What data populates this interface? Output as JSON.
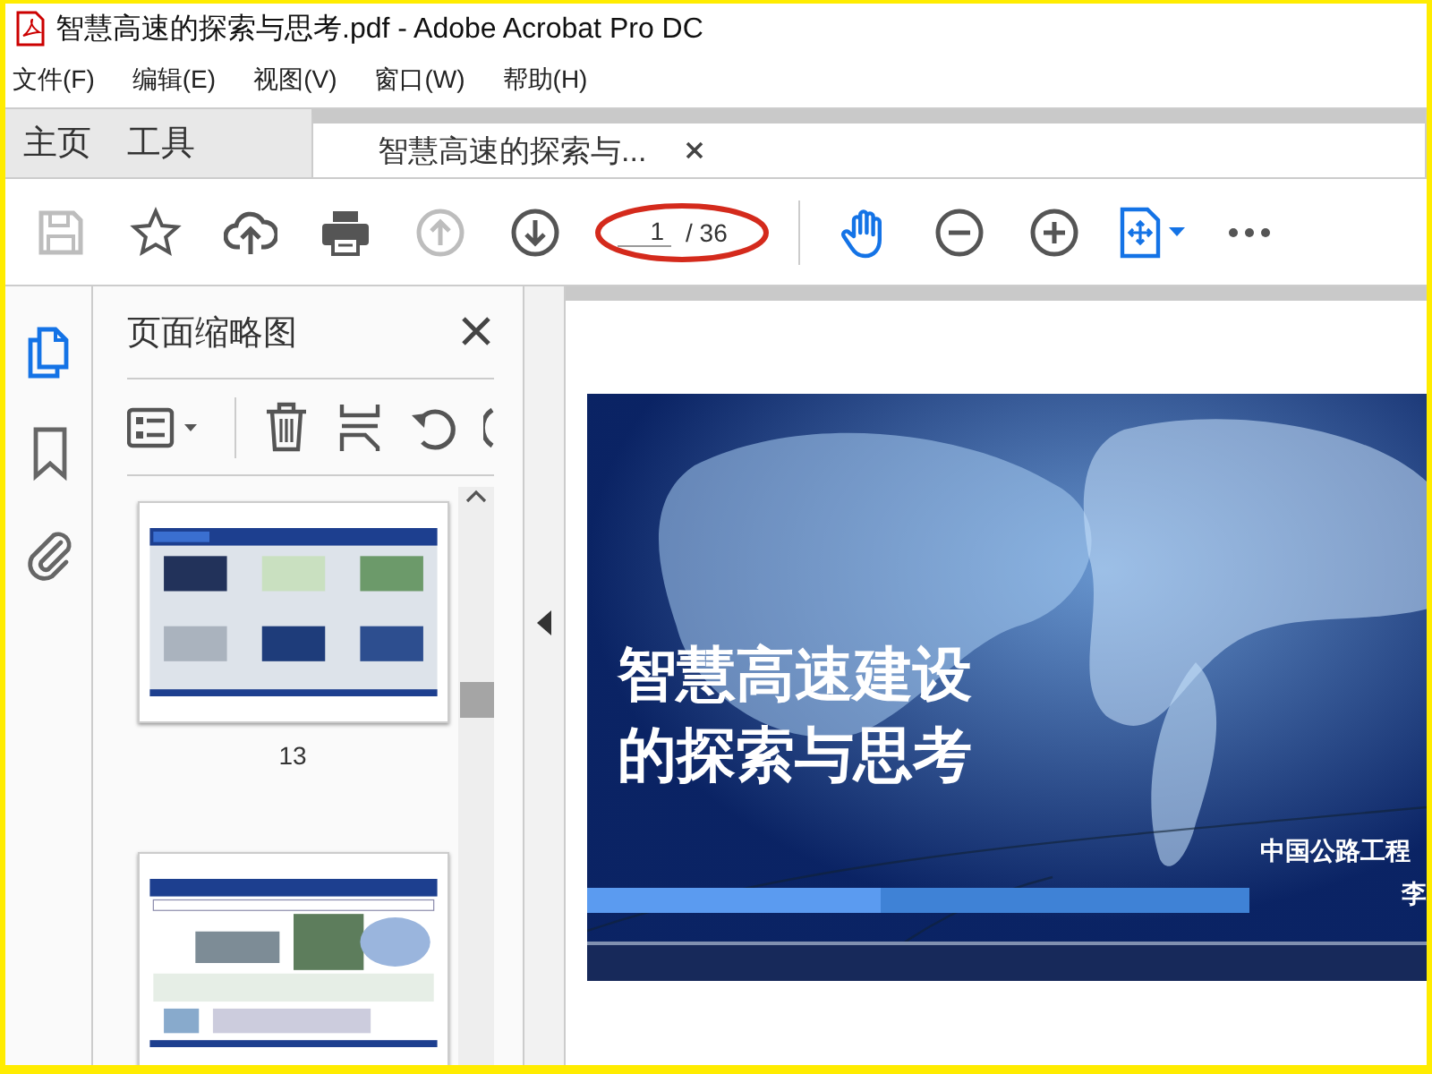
{
  "window": {
    "title": "智慧高速的探索与思考.pdf - Adobe Acrobat Pro DC"
  },
  "menu": [
    "文件(F)",
    "编辑(E)",
    "视图(V)",
    "窗口(W)",
    "帮助(H)"
  ],
  "tabs": [
    {
      "label": "主页",
      "kind": "nav",
      "selected": false
    },
    {
      "label": "工具",
      "kind": "nav",
      "selected": false
    },
    {
      "label": "智慧高速的探索与...",
      "kind": "document",
      "selected": true
    }
  ],
  "toolbar": [
    {
      "kind": "save",
      "disabled": true
    },
    {
      "kind": "star",
      "disabled": false
    },
    {
      "kind": "upload",
      "disabled": false
    },
    {
      "kind": "print",
      "disabled": false
    },
    {
      "kind": "prev-page",
      "disabled": true
    },
    {
      "kind": "next-page",
      "disabled": false
    },
    {
      "kind": "page-field"
    },
    {
      "kind": "separator"
    },
    {
      "kind": "hand",
      "disabled": false
    },
    {
      "kind": "zoom-out",
      "disabled": false
    },
    {
      "kind": "zoom-in",
      "disabled": false
    },
    {
      "kind": "fit",
      "disabled": false
    },
    {
      "kind": "more",
      "disabled": false
    }
  ],
  "page_field": {
    "value": "1",
    "total": "/ 36",
    "circled": true
  },
  "rail": [
    {
      "kind": "pages",
      "selected": true
    },
    {
      "kind": "bookmarks",
      "selected": false
    },
    {
      "kind": "attachments",
      "selected": false
    }
  ],
  "panel": {
    "title": "页面缩略图",
    "tools": [
      {
        "kind": "options"
      },
      {
        "kind": "delete"
      },
      {
        "kind": "extract"
      },
      {
        "kind": "rotate"
      },
      {
        "kind": "rotate-cut"
      }
    ],
    "thumbnails": [
      {
        "label": "13",
        "kind": "grid"
      },
      {
        "kind": "table"
      }
    ]
  },
  "slide": {
    "title_lines": [
      "智慧高速建设",
      "的探索与思考"
    ],
    "organization": "中国公路工程",
    "author": "李"
  }
}
